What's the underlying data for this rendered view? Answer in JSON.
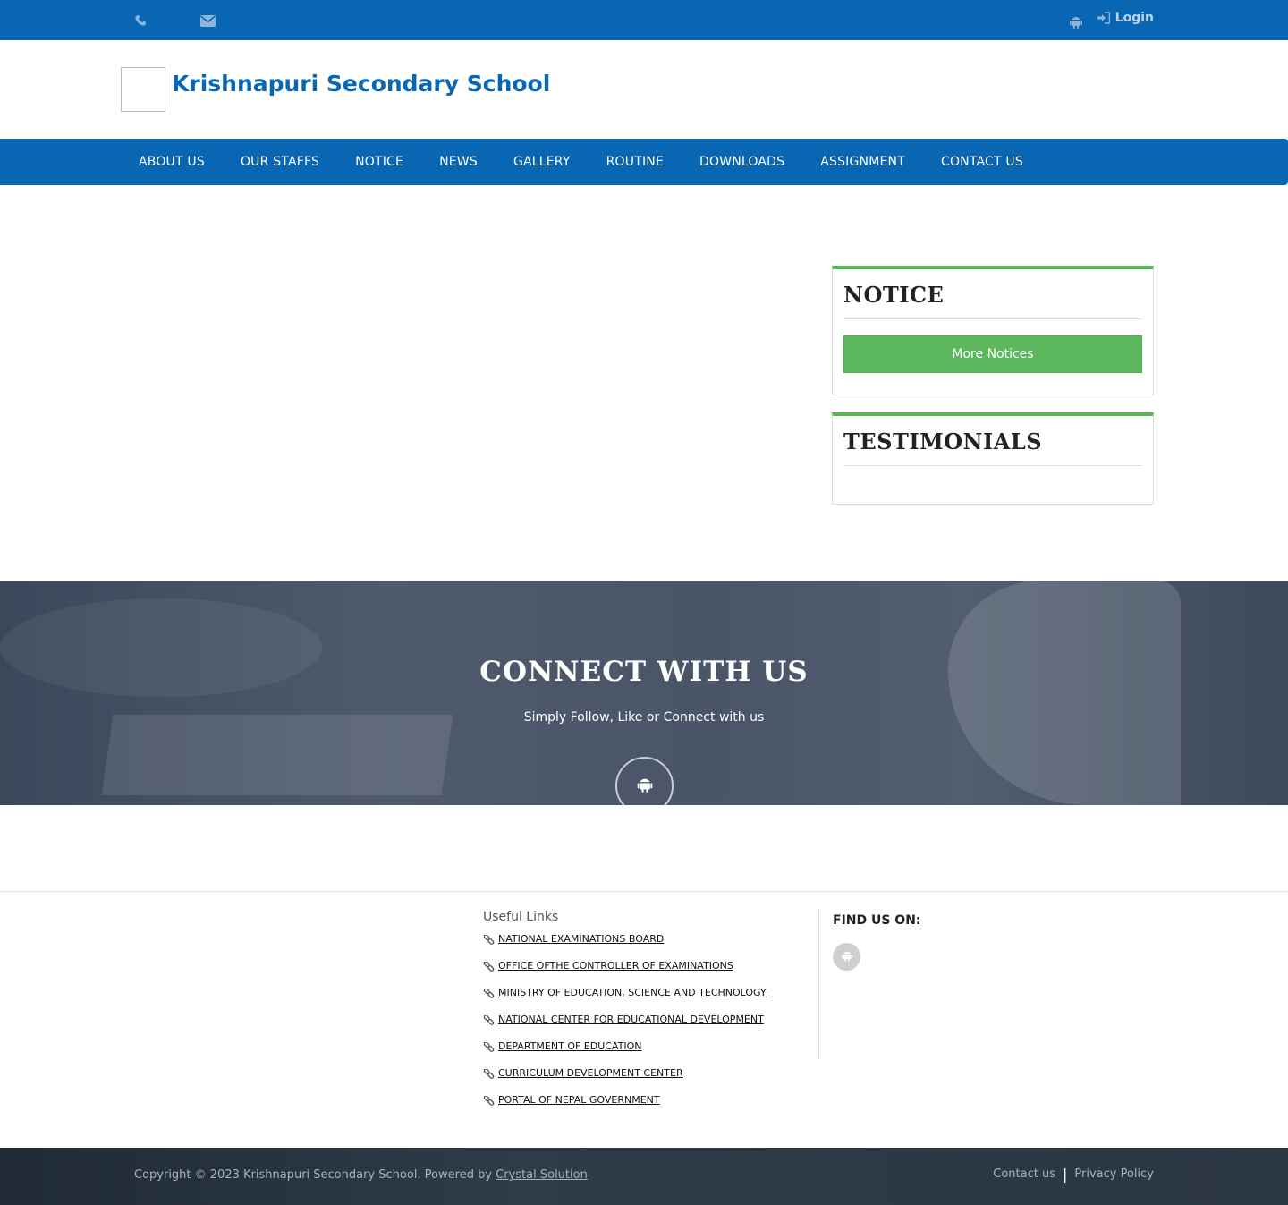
{
  "topbar": {
    "phone_icon": "phone-icon",
    "email_icon": "envelope-icon",
    "android_icon": "android-icon",
    "login_icon": "sign-in-icon",
    "login_label": "Login"
  },
  "header": {
    "school_name": "Krishnapuri Secondary School",
    "logo": "school-logo"
  },
  "nav": {
    "items": [
      "ABOUT US",
      "OUR STAFFS",
      "NOTICE",
      "NEWS",
      "GALLERY",
      "ROUTINE",
      "DOWNLOADS",
      "ASSIGNMENT",
      "CONTACT US"
    ]
  },
  "sidebar": {
    "notice_title": "NOTICE",
    "more_notices": "More Notices",
    "testimonials_title": "TESTIMONIALS"
  },
  "connect": {
    "title": "CONNECT WITH US",
    "subtitle": "Simply Follow, Like or Connect with us",
    "social_icon": "android-icon"
  },
  "footer": {
    "useful_links_title": "Useful Links",
    "useful_links": [
      "NATIONAL EXAMINATIONS BOARD",
      "OFFICE OFTHE CONTROLLER OF EXAMINATIONS",
      "MINISTRY OF EDUCATION, SCIENCE AND TECHNOLOGY",
      "NATIONAL CENTER FOR EDUCATIONAL DEVELOPMENT",
      "DEPARTMENT OF EDUCATION",
      "CURRICULUM DEVELOPMENT CENTER",
      "PORTAL OF NEPAL GOVERNMENT"
    ],
    "find_us_title": "FIND US ON:",
    "copyright_text": "Copyright © 2023 Krishnapuri Secondary School. Powered by ",
    "powered_by": "Crystal Solution",
    "contact_link": "Contact us",
    "separator": "|",
    "privacy_link": "Privacy Policy"
  },
  "colors": {
    "primary_blue": "#0866b3",
    "accent_green": "#5cb85c",
    "panel_border_green": "#4cbb4c",
    "footer_dark": "#2b3643"
  }
}
